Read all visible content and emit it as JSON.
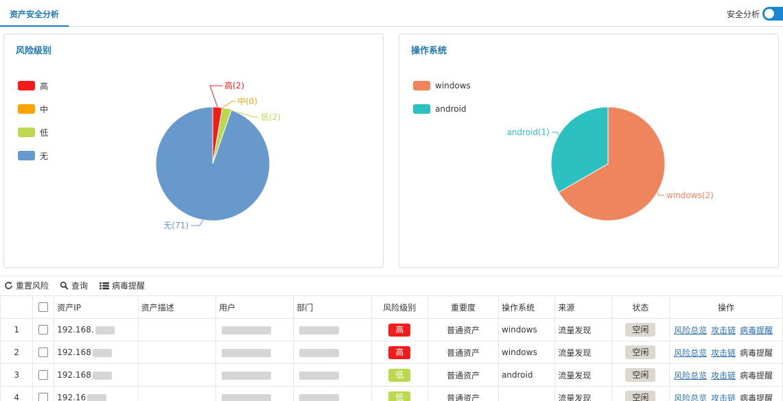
{
  "header": {
    "tab_label": "资产安全分析",
    "toggle_label": "安全分析",
    "toggle_on": true
  },
  "risk_panel": {
    "title": "风险级别",
    "legend": [
      {
        "label": "高",
        "color": "#f11d1d"
      },
      {
        "label": "中",
        "color": "#f7a404"
      },
      {
        "label": "低",
        "color": "#bcd84e"
      },
      {
        "label": "无",
        "color": "#6899cd"
      }
    ]
  },
  "os_panel": {
    "title": "操作系统",
    "legend": [
      {
        "label": "windows",
        "color": "#ef855d"
      },
      {
        "label": "android",
        "color": "#2cc1c0"
      }
    ]
  },
  "chart_data": [
    {
      "type": "pie",
      "title": "风险级别",
      "slices": [
        {
          "name": "高",
          "value": 2,
          "label": "高(2)",
          "color": "#f11d1d"
        },
        {
          "name": "中",
          "value": 0,
          "label": "中(0)",
          "color": "#f7a404"
        },
        {
          "name": "低",
          "value": 2,
          "label": "低(2)",
          "color": "#bcd84e"
        },
        {
          "name": "无",
          "value": 71,
          "label": "无(71)",
          "color": "#6899cd"
        }
      ],
      "legend_position": "left"
    },
    {
      "type": "pie",
      "title": "操作系统",
      "slices": [
        {
          "name": "windows",
          "value": 2,
          "label": "windows(2)",
          "color": "#ef855d"
        },
        {
          "name": "android",
          "value": 1,
          "label": "android(1)",
          "color": "#2cc1c0"
        }
      ],
      "legend_position": "left"
    }
  ],
  "toolbar": {
    "reset_label": "重置风险",
    "query_label": "查询",
    "virus_label": "病毒提醒"
  },
  "table": {
    "headers": [
      "",
      "",
      "资产IP",
      "资产描述",
      "用户",
      "部门",
      "风险级别",
      "重要度",
      "操作系统",
      "来源",
      "状态",
      "操作"
    ],
    "rows": [
      {
        "index": "1",
        "ip": "192.168.",
        "risk": "高",
        "risk_color": "#f11d1d",
        "importance": "普通资产",
        "os": "windows",
        "source": "流量发现",
        "status": "空闲",
        "op1": "风险总览",
        "op2": "攻击链",
        "op3": "病毒提醒",
        "op3_link": true
      },
      {
        "index": "2",
        "ip": "192.168",
        "risk": "高",
        "risk_color": "#f11d1d",
        "importance": "普通资产",
        "os": "windows",
        "source": "流量发现",
        "status": "空闲",
        "op1": "风险总览",
        "op2": "攻击链",
        "op3": "病毒提醒",
        "op3_link": false
      },
      {
        "index": "3",
        "ip": "192.168",
        "risk": "低",
        "risk_color": "#bcd84e",
        "importance": "普通资产",
        "os": "android",
        "source": "流量发现",
        "status": "空闲",
        "op1": "风险总览",
        "op2": "攻击链",
        "op3": "病毒提醒",
        "op3_link": false
      },
      {
        "index": "4",
        "ip": "192.16",
        "risk": "低",
        "risk_color": "#bcd84e",
        "importance": "普通资产",
        "os": "",
        "source": "流量发现",
        "status": "空闲",
        "op1": "风险总览",
        "op2": "攻击链",
        "op3": "病毒提醒",
        "op3_link": false
      }
    ]
  }
}
